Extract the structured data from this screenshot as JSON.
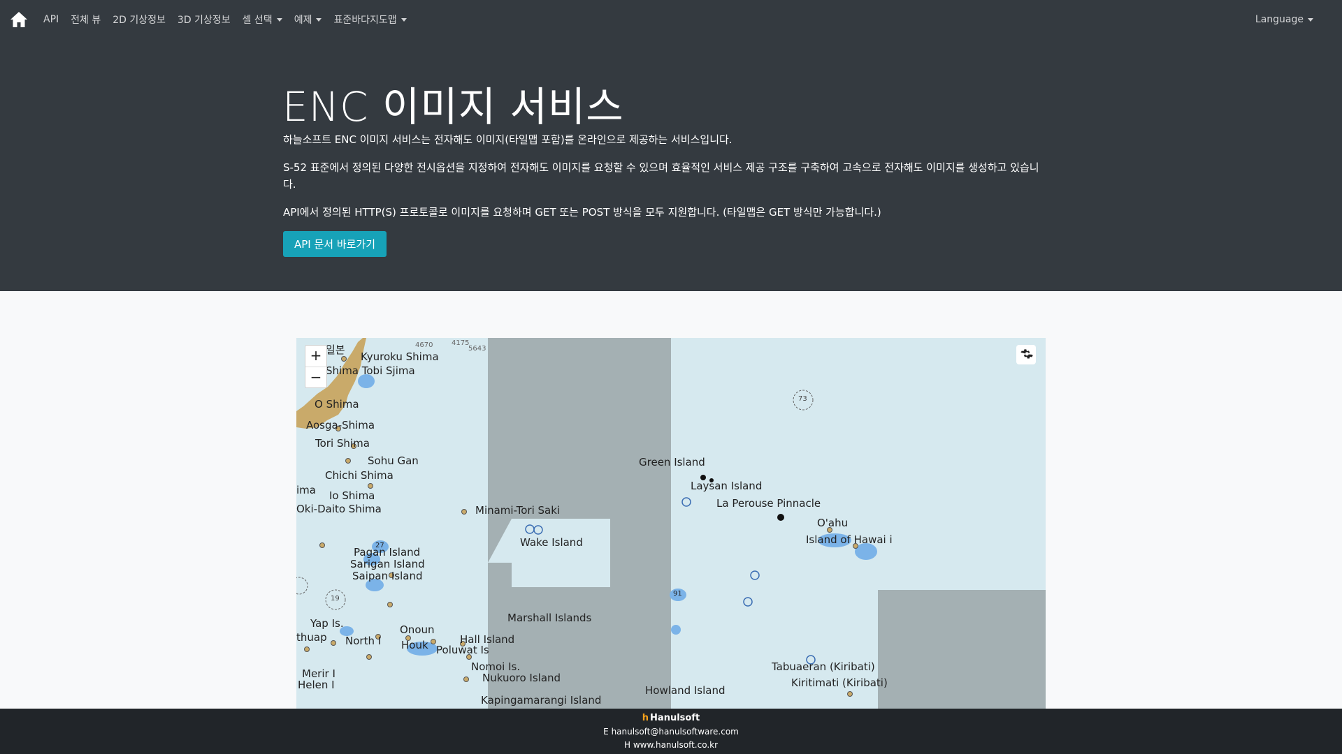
{
  "nav": {
    "items": [
      {
        "label": "API",
        "dropdown": false
      },
      {
        "label": "전체 뷰",
        "dropdown": false
      },
      {
        "label": "2D 기상정보",
        "dropdown": false
      },
      {
        "label": "3D 기상정보",
        "dropdown": false
      },
      {
        "label": "셀 선택",
        "dropdown": true
      },
      {
        "label": "예제",
        "dropdown": true
      },
      {
        "label": "표준바다지도맵",
        "dropdown": true
      }
    ],
    "language_label": "Language"
  },
  "hero": {
    "title": "ENC 이미지 서비스",
    "p1": "하늘소프트 ENC 이미지 서비스는 전자해도 이미지(타일맵 포함)를 온라인으로 제공하는 서비스입니다.",
    "p2": "S-52 표준에서 정의된 다양한 전시옵션을 지정하여 전자해도 이미지를 요청할 수 있으며 효율적인 서비스 제공 구조를 구축하여 고속으로 전자해도 이미지를 생성하고 있습니다.",
    "p3": "API에서 정의된 HTTP(S) 프로토콜로 이미지를 요청하며 GET 또는 POST 방식을 모두 지원합니다. (타일맵은 GET 방식만 가능합니다.)",
    "button_label": "API 문서 바로가기"
  },
  "map": {
    "zoom_in": "+",
    "zoom_out": "−",
    "labels": [
      {
        "text": "일본",
        "id": "label-japan"
      },
      {
        "text": "Kyuroku Shima",
        "id": "label-kyuroku-shima"
      },
      {
        "text": "Shima Tobi Sjima",
        "id": "label-tobi-sjima"
      },
      {
        "text": "O Shima",
        "id": "label-o-shima"
      },
      {
        "text": "Aosga-Shima",
        "id": "label-aosga-shima"
      },
      {
        "text": "Tori Shima",
        "id": "label-tori-shima"
      },
      {
        "text": "Sohu Gan",
        "id": "label-sohu-gan"
      },
      {
        "text": "Chichi Shima",
        "id": "label-chichi-shima"
      },
      {
        "text": "Io Shima",
        "id": "label-io-shima"
      },
      {
        "text": "Oki-Daito Shima",
        "id": "label-oki-daito-shima"
      },
      {
        "text": "Minami-Tori Saki",
        "id": "label-minami-tori-saki"
      },
      {
        "text": "Wake Island",
        "id": "label-wake-island"
      },
      {
        "text": "Green Island",
        "id": "label-green-island"
      },
      {
        "text": "Laysan Island",
        "id": "label-laysan-island"
      },
      {
        "text": "La Perouse Pinnacle",
        "id": "label-la-perouse-pinnacle"
      },
      {
        "text": "O'ahu",
        "id": "label-oahu"
      },
      {
        "text": "Island of Hawai i",
        "id": "label-island-of-hawaii"
      },
      {
        "text": "Pagan Island",
        "id": "label-pagan-island"
      },
      {
        "text": "Sarigan Island",
        "id": "label-sarigan-island"
      },
      {
        "text": "Saipan Island",
        "id": "label-saipan-island"
      },
      {
        "text": "Marshall Islands",
        "id": "label-marshall-islands"
      },
      {
        "text": "Yap Is.",
        "id": "label-yap-is"
      },
      {
        "text": "Onoun",
        "id": "label-onoun"
      },
      {
        "text": "North I",
        "id": "label-north-i"
      },
      {
        "text": "Hall Island",
        "id": "label-hall-island"
      },
      {
        "text": "Houk",
        "id": "label-houk"
      },
      {
        "text": "Poluwat Is",
        "id": "label-poluwat-is"
      },
      {
        "text": "Nomoi Is.",
        "id": "label-nomoi-is"
      },
      {
        "text": "Nukuoro Island",
        "id": "label-nukuoro-island"
      },
      {
        "text": "Kapingamarangi Island",
        "id": "label-kapingamarangi-island"
      },
      {
        "text": "Merir I",
        "id": "label-merir-i"
      },
      {
        "text": "Helen I",
        "id": "label-helen-i"
      },
      {
        "text": "Howland Island",
        "id": "label-howland-island"
      },
      {
        "text": "Tabuaeran (Kiribati)",
        "id": "label-tabuaeran"
      },
      {
        "text": "Kiritimati (Kiribati)",
        "id": "label-kiritimati"
      },
      {
        "text": "thuap",
        "id": "label-thuap"
      },
      {
        "text": "ima",
        "id": "label-ima"
      },
      {
        "text": "4175",
        "id": "label-depth-4175"
      },
      {
        "text": "4670",
        "id": "label-depth-4670"
      },
      {
        "text": "5643",
        "id": "label-depth-5643"
      },
      {
        "text": "73",
        "id": "label-zone-73"
      },
      {
        "text": "27",
        "id": "label-zone-27"
      },
      {
        "text": "19",
        "id": "label-zone-19"
      },
      {
        "text": "91",
        "id": "label-zone-91"
      }
    ],
    "colors": {
      "sea": "#d6e9ef",
      "nodata": "#a4b0b3",
      "land": "#c9aa6a",
      "shallow": "#7bb3e8"
    }
  },
  "footer": {
    "brand_mark": "h",
    "brand": "Hanulsoft",
    "email_prefix": "E",
    "email": "hanulsoft@hanulsoftware.com",
    "web_prefix": "H",
    "web": "www.hanulsoft.co.kr"
  }
}
